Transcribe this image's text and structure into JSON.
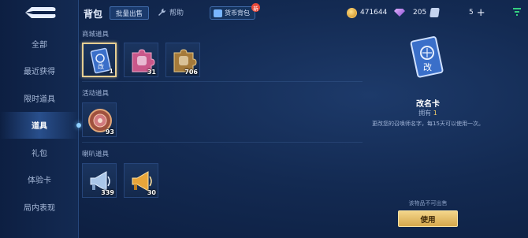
{
  "header": {
    "title": "背包",
    "batch_sell_label": "批量出售",
    "help_label": "帮助",
    "currency_bag_label": "货币背包",
    "new_badge": "新",
    "gold": "471644",
    "gems": "205",
    "coupons": "5"
  },
  "sidebar": {
    "items": [
      {
        "label": "全部"
      },
      {
        "label": "最近获得"
      },
      {
        "label": "限时道具"
      },
      {
        "label": "道具"
      },
      {
        "label": "礼包"
      },
      {
        "label": "体验卡"
      },
      {
        "label": "局内表现"
      }
    ],
    "active_index": 3
  },
  "sections": {
    "mall": {
      "label": "商城道具",
      "items": [
        {
          "name": "rename-card",
          "count": "1"
        },
        {
          "name": "pink-puzzle-piece",
          "count": "31"
        },
        {
          "name": "gold-puzzle-piece",
          "count": "706"
        }
      ]
    },
    "activity": {
      "label": "活动道具",
      "items": [
        {
          "name": "activity-badge",
          "count": "93"
        }
      ]
    },
    "speaker": {
      "label": "喇叭道具",
      "items": [
        {
          "name": "silver-megaphone",
          "count": "339"
        },
        {
          "name": "gold-megaphone",
          "count": "30"
        }
      ]
    }
  },
  "detail": {
    "name": "改名卡",
    "own_prefix": "拥有",
    "own_count": "1",
    "description": "更改您的召唤师名字，每15天可以使用一次。",
    "not_sellable": "该物品不可出售",
    "use_label": "使用",
    "card_glyph": "改"
  },
  "colors": {
    "accent_gold": "#e7cf93",
    "use_button": "#d6a84c",
    "background": "#132a52"
  }
}
